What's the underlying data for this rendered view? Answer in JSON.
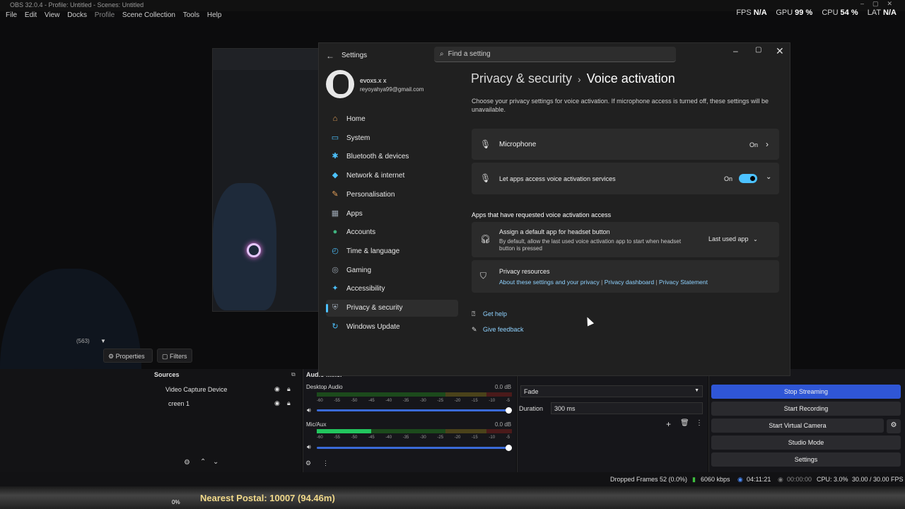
{
  "obs": {
    "title": "OBS 32.0.4 - Profile: Untitled - Scenes: Untitled",
    "menu": [
      "File",
      "Edit",
      "View",
      "Docks",
      "Profile",
      "Scene Collection",
      "Tools",
      "Help"
    ],
    "stats": [
      {
        "label": "FPS",
        "value": "N/A"
      },
      {
        "label": "GPU",
        "value": "99 %"
      },
      {
        "label": "CPU",
        "value": "54 %"
      },
      {
        "label": "LAT",
        "value": "N/A"
      }
    ],
    "preview_zoom": "(563)",
    "properties_label": "Properties",
    "filters_label": "Filters",
    "sources_title": "Sources",
    "sources": [
      "Video Capture Device",
      "creen 1"
    ],
    "audio_title": "Audio Mixer",
    "audio": [
      {
        "name": "Desktop Audio",
        "db": "0.0 dB",
        "level": 0
      },
      {
        "name": "Mic/Aux",
        "db": "0.0 dB",
        "level": 0.28
      }
    ],
    "meter_scale": "-60 -55 -50 -45 -40 -35 -30 -25 -20 -15 -10 -5 0",
    "transition": "Fade",
    "duration_label": "Duration",
    "duration_value": "300 ms",
    "controls": [
      "Stop Streaming",
      "Start Recording",
      "Start Virtual Camera",
      "Studio Mode",
      "Settings"
    ],
    "status": {
      "dropped": "Dropped Frames 52 (0.0%)",
      "bitrate": "6060 kbps",
      "live_time": "04:11:21",
      "rec_time": "00:00:00",
      "cpu": "CPU: 3.0%",
      "fps": "30.00 / 30.00 FPS"
    },
    "nearest_postal": "Nearest Postal: 10007 (94.46m)",
    "percent_bottom": "0%"
  },
  "settings": {
    "app_title": "Settings",
    "search_placeholder": "Find a setting",
    "user": {
      "name": "evoxs.x x",
      "email": "reyoyahya99@gmail.com"
    },
    "nav": [
      {
        "label": "Home",
        "icon": "⌂",
        "color": "#e8a25a"
      },
      {
        "label": "System",
        "icon": "▭",
        "color": "#4cc2ff"
      },
      {
        "label": "Bluetooth & devices",
        "icon": "✱",
        "color": "#4cc2ff"
      },
      {
        "label": "Network & internet",
        "icon": "◆",
        "color": "#4cc2ff"
      },
      {
        "label": "Personalisation",
        "icon": "✎",
        "color": "#e8a25a"
      },
      {
        "label": "Apps",
        "icon": "▦",
        "color": "#9aa5b1"
      },
      {
        "label": "Accounts",
        "icon": "●",
        "color": "#3fb37f"
      },
      {
        "label": "Time & language",
        "icon": "◴",
        "color": "#4cc2ff"
      },
      {
        "label": "Gaming",
        "icon": "◎",
        "color": "#9aa5b1"
      },
      {
        "label": "Accessibility",
        "icon": "✦",
        "color": "#4cc2ff"
      },
      {
        "label": "Privacy & security",
        "icon": "⛨",
        "color": "#9aa5b1"
      },
      {
        "label": "Windows Update",
        "icon": "↻",
        "color": "#4cc2ff"
      }
    ],
    "breadcrumb_parent": "Privacy & security",
    "breadcrumb_current": "Voice activation",
    "description": "Choose your privacy settings for voice activation. If microphone access is turned off, these settings will be unavailable.",
    "microphone_label": "Microphone",
    "microphone_state": "On",
    "let_apps_label": "Let apps access voice activation services",
    "let_apps_state": "On",
    "section_heading": "Apps that have requested voice activation access",
    "headset_title": "Assign a default app for headset button",
    "headset_sub": "By default, allow the last used voice activation app to start when headset button is pressed",
    "headset_value": "Last used app",
    "resources_title": "Privacy resources",
    "resources_links": [
      "About these settings and your privacy",
      "Privacy dashboard",
      "Privacy Statement"
    ],
    "get_help": "Get help",
    "give_feedback": "Give feedback"
  }
}
